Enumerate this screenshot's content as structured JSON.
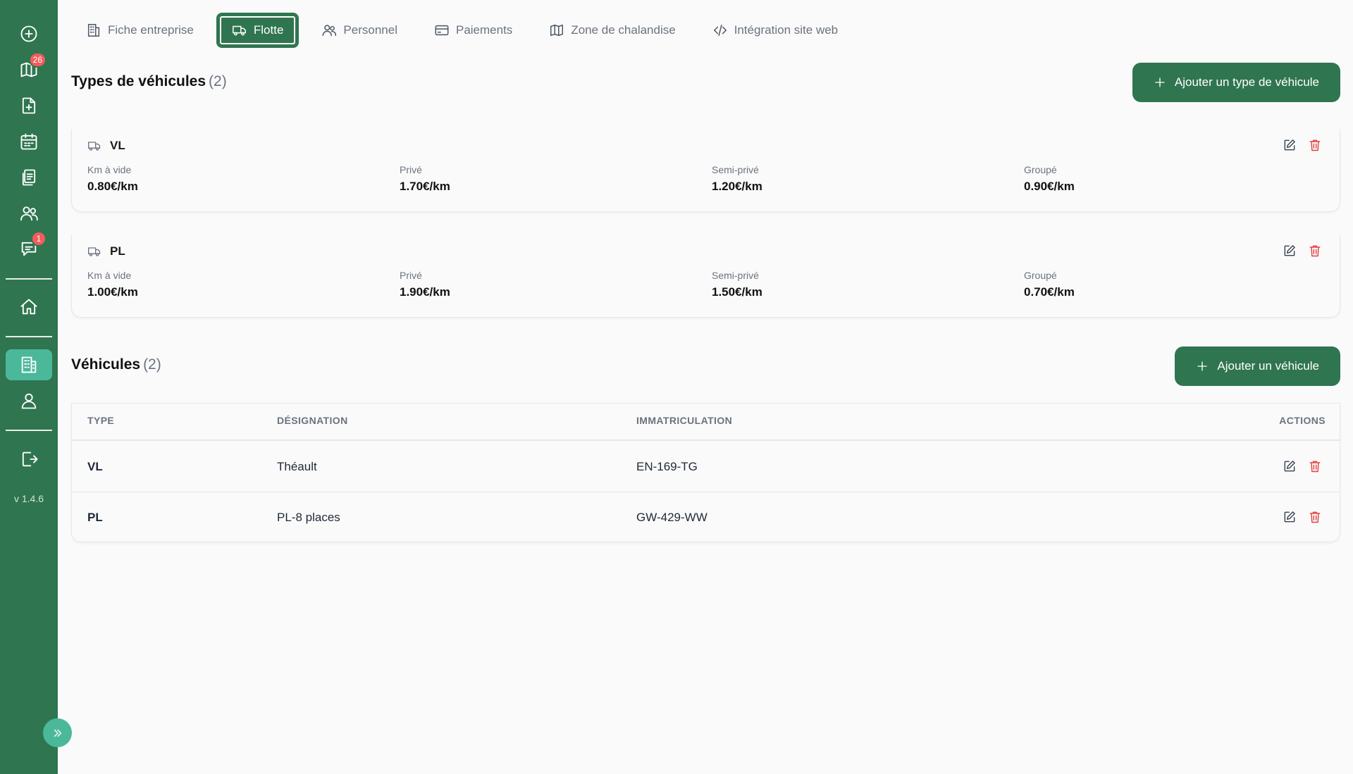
{
  "sidebar": {
    "items": [
      {
        "name": "add-circle-icon",
        "badge": ""
      },
      {
        "name": "map-icon",
        "badge": "26"
      },
      {
        "name": "new-document-icon",
        "badge": ""
      },
      {
        "name": "calendar-icon",
        "badge": ""
      },
      {
        "name": "documents-icon",
        "badge": ""
      },
      {
        "name": "users-icon",
        "badge": ""
      },
      {
        "name": "chat-icon",
        "badge": "1"
      }
    ],
    "version": "v 1.4.6"
  },
  "tabs": [
    {
      "label": "Fiche entreprise",
      "icon": "building-icon",
      "active": false
    },
    {
      "label": "Flotte",
      "icon": "truck-icon",
      "active": true
    },
    {
      "label": "Personnel",
      "icon": "users-icon",
      "active": false
    },
    {
      "label": "Paiements",
      "icon": "credit-card-icon",
      "active": false
    },
    {
      "label": "Zone de chalandise",
      "icon": "map-icon",
      "active": false
    },
    {
      "label": "Intégration site web",
      "icon": "code-icon",
      "active": false
    }
  ],
  "vehicle_types": {
    "title": "Types de véhicules",
    "count": "(2)",
    "add_label": "Ajouter un type de véhicule",
    "rate_labels": {
      "empty": "Km à vide",
      "private": "Privé",
      "semi_private": "Semi-privé",
      "grouped": "Groupé"
    },
    "items": [
      {
        "name": "VL",
        "empty": "0.80€/km",
        "private": "1.70€/km",
        "semi_private": "1.20€/km",
        "grouped": "0.90€/km"
      },
      {
        "name": "PL",
        "empty": "1.00€/km",
        "private": "1.90€/km",
        "semi_private": "1.50€/km",
        "grouped": "0.70€/km"
      }
    ]
  },
  "vehicles": {
    "title": "Véhicules",
    "count": "(2)",
    "add_label": "Ajouter un véhicule",
    "columns": {
      "type": "TYPE",
      "designation": "DÉSIGNATION",
      "plate": "IMMATRICULATION",
      "actions": "ACTIONS"
    },
    "rows": [
      {
        "type": "VL",
        "designation": "Théault",
        "plate": "EN-169-TG"
      },
      {
        "type": "PL",
        "designation": "PL-8 places",
        "plate": "GW-429-WW"
      }
    ]
  },
  "colors": {
    "primary": "#2f7550",
    "accent": "#4bb89a",
    "danger": "#e53e3e"
  }
}
